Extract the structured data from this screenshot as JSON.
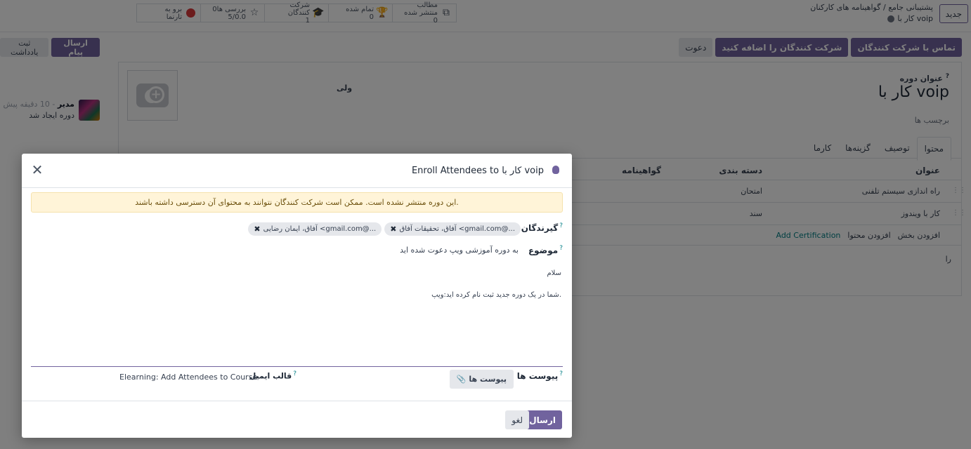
{
  "topbar": {
    "new_button": "جدید",
    "breadcrumb_root": "گواهینامه های کارکنان",
    "breadcrumb_sep": "/",
    "breadcrumb_parent": "پشتیبانی جامع",
    "breadcrumb_current": "کار با voip"
  },
  "stats": [
    {
      "label": "مطالب منتشر شده",
      "value": "0",
      "icon": "copy-icon"
    },
    {
      "label": "تمام شده",
      "value": "0",
      "icon": "trophy-icon"
    },
    {
      "label": "شرکت کنندگان",
      "value": "1",
      "icon": "graduation-cap-icon"
    },
    {
      "label": "0بررسی ها",
      "value": "5/0.0",
      "icon": "star-icon"
    },
    {
      "label": "برو به",
      "value": "تارنما",
      "icon": "globe-icon"
    }
  ],
  "actions": {
    "contact_attendees": "تماس با شرکت کنندگان",
    "add_attendees": "شرکت کنندگان را اضافه کنید",
    "invite": "دعوت"
  },
  "chatter": {
    "send_message": "ارسال پیام",
    "log_note": "ثبت یادداشت",
    "author": "مدیر",
    "time": "- 10 دقیقه پیش",
    "message": "دوره ایجاد شد"
  },
  "form": {
    "title_label": "عنوان دوره",
    "title_help": "?",
    "title": "کار با voip",
    "tags_placeholder": "برچسب ها",
    "responsible": "ولی",
    "tabs": [
      "محتوا",
      "توصیف",
      "گزینه‌ها",
      "کارما"
    ],
    "table_headers": {
      "title": "عنوان",
      "category": "دسته بندی",
      "certification": "گواهینامه"
    },
    "rows": [
      {
        "title": "راه اندازی سیستم تلفنی",
        "category": "امتحان"
      },
      {
        "title": "کار با ویندوز",
        "category": "سند"
      }
    ],
    "links": {
      "add_section": "افزودن بخش",
      "add_content": "افزودن محتوا",
      "add_certification": "Add Certification"
    },
    "extra": "را"
  },
  "modal": {
    "title": "Enroll Attendees to کار با voip",
    "alert": "این دوره منتشر نشده است. ممکن است شرکت کنندگان نتوانند به محتوای آن دسترسی داشته باشند.",
    "recipients_label": "گیرندگان",
    "recipients": [
      "آفاق، تحقیقات آفاق <gmail.com@...",
      "آفاق، ایمان رضایی <gmail.com@..."
    ],
    "subject_label": "موضوع",
    "subject": "به دوره آموزشی ویپ دعوت شده اید",
    "body_greeting": "سلام",
    "body_text": "شما در یک دوره جدید ثبت نام کرده اید:ویپ.",
    "attachments_label": "پیوست ها",
    "attachments_button": "پیوست ها",
    "template_label": "قالب ایمیل",
    "template_value": "Elearning: Add Attendees to Course",
    "help_mark": "?",
    "send": "ارسال",
    "cancel": "لغو"
  },
  "colors": {
    "primary": "#71639e",
    "alert_bg": "#fff4d8",
    "link": "#017e84"
  }
}
